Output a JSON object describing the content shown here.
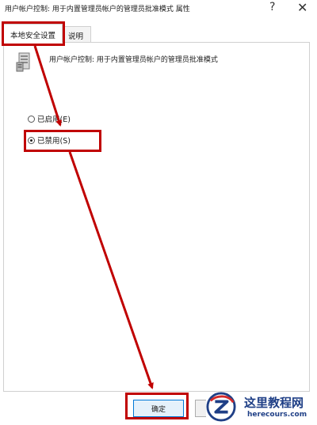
{
  "window": {
    "title": "用户帐户控制: 用于内置管理员帐户的管理员批准模式 属性",
    "help_glyph": "?",
    "close_glyph": "✕"
  },
  "tabs": [
    {
      "label": "本地安全设置",
      "active": true
    },
    {
      "label": "说明",
      "active": false
    }
  ],
  "policy": {
    "title": "用户帐户控制: 用于内置管理员帐户的管理员批准模式",
    "icon": "policy-server-icon"
  },
  "options": [
    {
      "label": "已启用(E)",
      "selected": false
    },
    {
      "label": "已禁用(S)",
      "selected": true
    }
  ],
  "buttons": {
    "ok": "确定",
    "cancel": ""
  },
  "annotations": {
    "color": "#c00000"
  },
  "watermark": {
    "cn": "这里教程网",
    "en": "herecours.com",
    "brand_color": "#1f3f86",
    "accent_color": "#d42a2a"
  }
}
